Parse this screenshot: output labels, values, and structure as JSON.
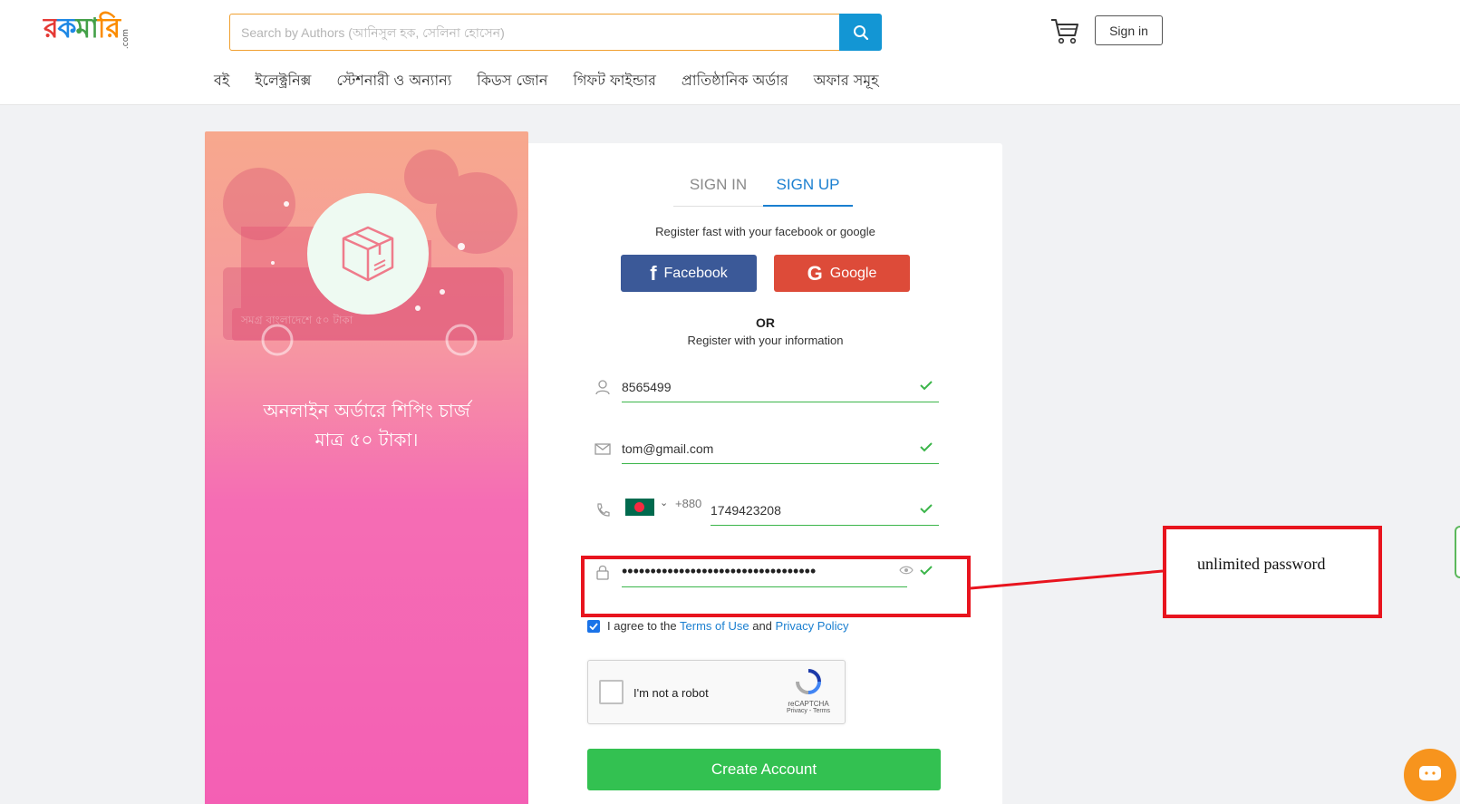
{
  "header": {
    "logo": {
      "part1": "র",
      "part2": "ক",
      "part3": "মা",
      "part4": "রি",
      "suffix": ".com"
    },
    "search_placeholder": "Search by Authors (আনিসুল হক, সেলিনা হোসেন)",
    "signin_label": "Sign in",
    "nav": [
      "বই",
      "ইলেক্ট্রনিক্স",
      "স্টেশনারী ও অন্যান্য",
      "কিডস জোন",
      "গিফট ফাইন্ডার",
      "প্রাতিষ্ঠানিক অর্ডার",
      "অফার সমূহ"
    ]
  },
  "promo": {
    "line1": "অনলাইন অর্ডারে শিপিং চার্জ",
    "line2": "মাত্র ৫০ টাকা।",
    "truck_text": "সমগ্র বাংলাদেশে ৫০ টাকা"
  },
  "form": {
    "tabs": [
      "SIGN IN",
      "SIGN UP"
    ],
    "active_tab": "SIGN UP",
    "register_fast": "Register fast with your facebook or google",
    "facebook_label": "Facebook",
    "google_label": "Google",
    "or_label": "OR",
    "register_info": "Register with your information",
    "name_value": "8565499",
    "email_value": "tom@gmail.com",
    "phone_code": "+880",
    "phone_value": "1749423208",
    "password_value": "••••••••••••••••••••••••••••••••••",
    "agree_prefix": "I agree to the",
    "terms_label": "Terms of Use",
    "agree_and": "and",
    "privacy_label": "Privacy Policy",
    "captcha_label": "I'm not a robot",
    "captcha_brand": "reCAPTCHA",
    "captcha_links": "Privacy - Terms",
    "create_label": "Create Account"
  },
  "annotation": {
    "text": "unlimited password",
    "color": "#e8141e"
  },
  "colors": {
    "accent_blue": "#1396d4",
    "facebook": "#3b5998",
    "google": "#dd4b39",
    "create_green": "#33c151",
    "valid_green": "#3bb54a"
  }
}
